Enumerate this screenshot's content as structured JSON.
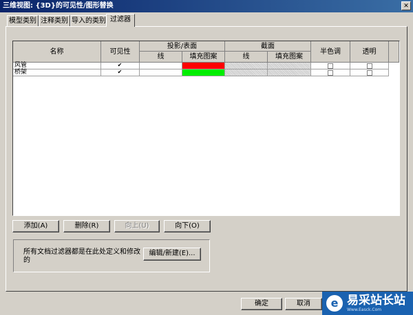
{
  "window": {
    "title": "三维视图: {3D}的可见性/图形替换",
    "close_glyph": "✕"
  },
  "tabs": [
    {
      "label": "模型类别",
      "active": false
    },
    {
      "label": "注释类别",
      "active": false
    },
    {
      "label": "导入的类别",
      "active": false
    },
    {
      "label": "过滤器",
      "active": true
    }
  ],
  "table": {
    "headers": {
      "name": "名称",
      "visibility": "可见性",
      "projection": "投影/表面",
      "projection_line": "线",
      "projection_pattern": "填充图案",
      "cut": "截面",
      "cut_line": "线",
      "cut_pattern": "填充图案",
      "halftone": "半色调",
      "transparent": "透明"
    },
    "rows": [
      {
        "name": "风管",
        "visible": "✔",
        "projection_pattern_color": "#ff0000",
        "halftone": "",
        "transparent": ""
      },
      {
        "name": "桥架",
        "visible": "✔",
        "projection_pattern_color": "#00ee00",
        "halftone": "",
        "transparent": ""
      }
    ]
  },
  "buttons": {
    "add": "添加(A)",
    "delete": "删除(R)",
    "up": "向上(U)",
    "down": "向下(O)",
    "edit": "编辑/新建(E)...",
    "ok": "确定",
    "cancel": "取消"
  },
  "info_text": "所有文档过滤器都是在此处定义和修改的",
  "watermark": {
    "text": "易采站长站",
    "sub": "Www.Easck.Com",
    "icon": "e"
  }
}
